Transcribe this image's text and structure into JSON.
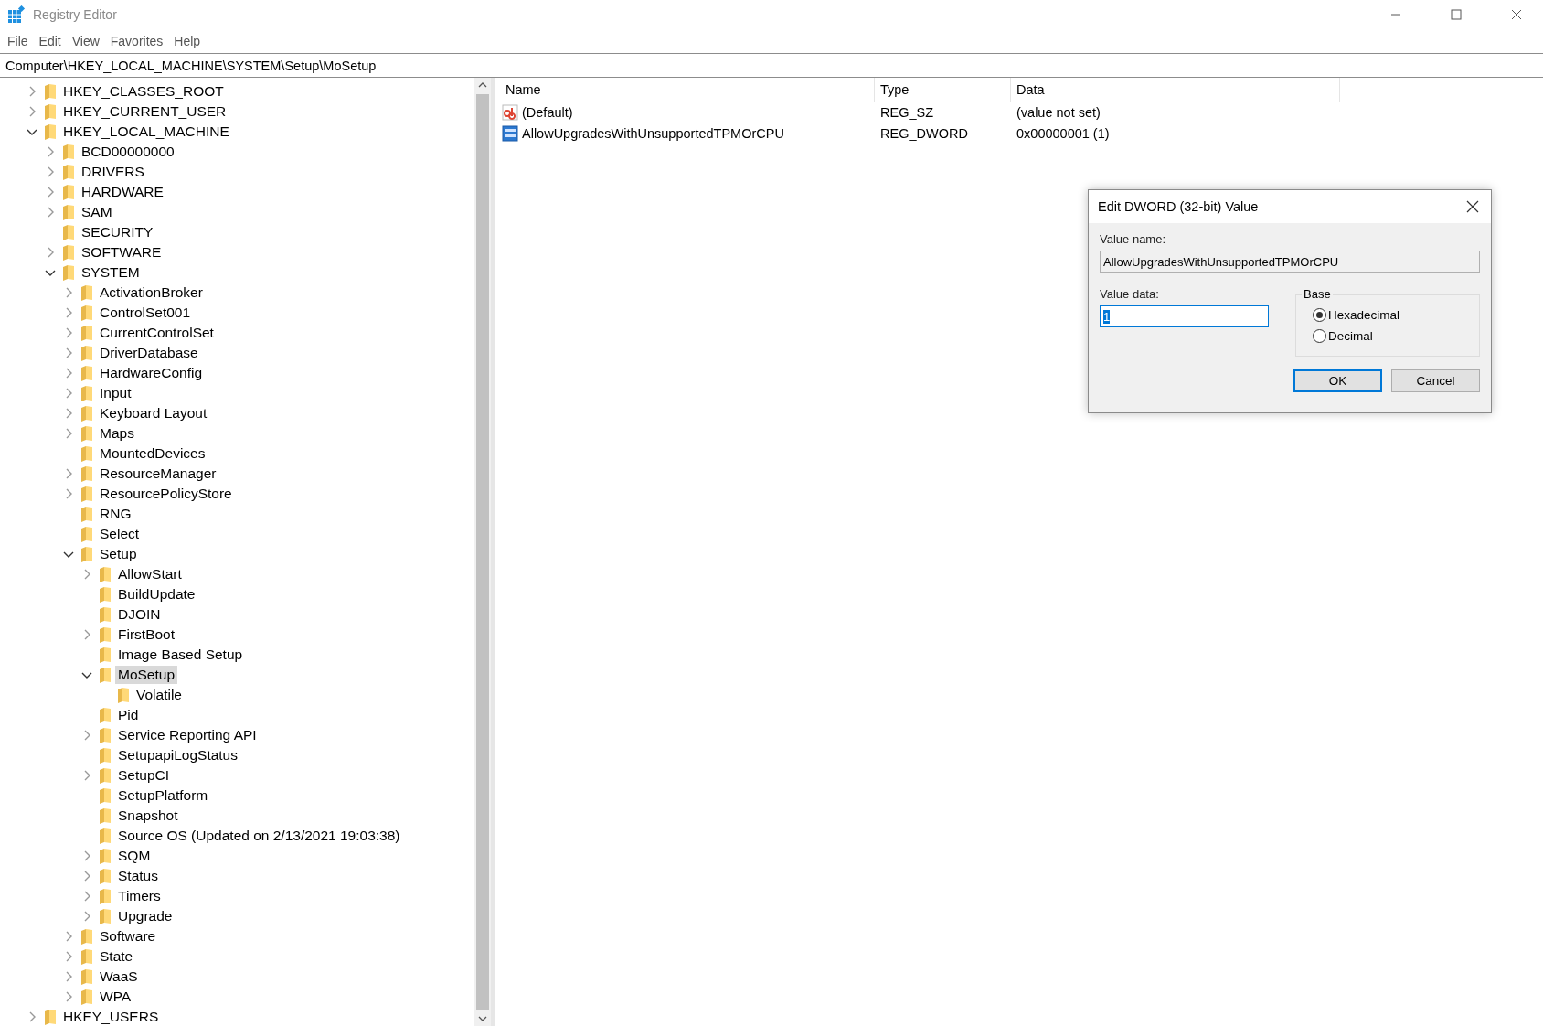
{
  "window": {
    "title": "Registry Editor"
  },
  "menu": [
    "File",
    "Edit",
    "View",
    "Favorites",
    "Help"
  ],
  "address": "Computer\\HKEY_LOCAL_MACHINE\\SYSTEM\\Setup\\MoSetup",
  "tree": [
    {
      "label": "HKEY_CLASSES_ROOT",
      "expandable": true,
      "expanded": false,
      "selected": false
    },
    {
      "label": "HKEY_CURRENT_USER",
      "expandable": true,
      "expanded": false,
      "selected": false
    },
    {
      "label": "HKEY_LOCAL_MACHINE",
      "expandable": true,
      "expanded": true,
      "selected": false,
      "children": [
        {
          "label": "BCD00000000",
          "expandable": true,
          "expanded": false,
          "selected": false
        },
        {
          "label": "DRIVERS",
          "expandable": true,
          "expanded": false,
          "selected": false
        },
        {
          "label": "HARDWARE",
          "expandable": true,
          "expanded": false,
          "selected": false
        },
        {
          "label": "SAM",
          "expandable": true,
          "expanded": false,
          "selected": false
        },
        {
          "label": "SECURITY",
          "expandable": false,
          "selected": false
        },
        {
          "label": "SOFTWARE",
          "expandable": true,
          "expanded": false,
          "selected": false
        },
        {
          "label": "SYSTEM",
          "expandable": true,
          "expanded": true,
          "selected": false,
          "children": [
            {
              "label": "ActivationBroker",
              "expandable": true,
              "expanded": false,
              "selected": false
            },
            {
              "label": "ControlSet001",
              "expandable": true,
              "expanded": false,
              "selected": false
            },
            {
              "label": "CurrentControlSet",
              "expandable": true,
              "expanded": false,
              "selected": false
            },
            {
              "label": "DriverDatabase",
              "expandable": true,
              "expanded": false,
              "selected": false
            },
            {
              "label": "HardwareConfig",
              "expandable": true,
              "expanded": false,
              "selected": false
            },
            {
              "label": "Input",
              "expandable": true,
              "expanded": false,
              "selected": false
            },
            {
              "label": "Keyboard Layout",
              "expandable": true,
              "expanded": false,
              "selected": false
            },
            {
              "label": "Maps",
              "expandable": true,
              "expanded": false,
              "selected": false
            },
            {
              "label": "MountedDevices",
              "expandable": false,
              "selected": false
            },
            {
              "label": "ResourceManager",
              "expandable": true,
              "expanded": false,
              "selected": false
            },
            {
              "label": "ResourcePolicyStore",
              "expandable": true,
              "expanded": false,
              "selected": false
            },
            {
              "label": "RNG",
              "expandable": false,
              "selected": false
            },
            {
              "label": "Select",
              "expandable": false,
              "selected": false
            },
            {
              "label": "Setup",
              "expandable": true,
              "expanded": true,
              "selected": false,
              "children": [
                {
                  "label": "AllowStart",
                  "expandable": true,
                  "expanded": false,
                  "selected": false
                },
                {
                  "label": "BuildUpdate",
                  "expandable": false,
                  "selected": false
                },
                {
                  "label": "DJOIN",
                  "expandable": false,
                  "selected": false
                },
                {
                  "label": "FirstBoot",
                  "expandable": true,
                  "expanded": false,
                  "selected": false
                },
                {
                  "label": "Image Based Setup",
                  "expandable": false,
                  "selected": false
                },
                {
                  "label": "MoSetup",
                  "expandable": true,
                  "expanded": true,
                  "selected": true,
                  "children": [
                    {
                      "label": "Volatile",
                      "expandable": false,
                      "selected": false
                    }
                  ]
                },
                {
                  "label": "Pid",
                  "expandable": false,
                  "selected": false
                },
                {
                  "label": "Service Reporting API",
                  "expandable": true,
                  "expanded": false,
                  "selected": false
                },
                {
                  "label": "SetupapiLogStatus",
                  "expandable": false,
                  "selected": false
                },
                {
                  "label": "SetupCI",
                  "expandable": true,
                  "expanded": false,
                  "selected": false
                },
                {
                  "label": "SetupPlatform",
                  "expandable": false,
                  "selected": false
                },
                {
                  "label": "Snapshot",
                  "expandable": false,
                  "selected": false
                },
                {
                  "label": "Source OS (Updated on 2/13/2021 19:03:38)",
                  "expandable": false,
                  "selected": false
                },
                {
                  "label": "SQM",
                  "expandable": true,
                  "expanded": false,
                  "selected": false
                },
                {
                  "label": "Status",
                  "expandable": true,
                  "expanded": false,
                  "selected": false
                },
                {
                  "label": "Timers",
                  "expandable": true,
                  "expanded": false,
                  "selected": false
                },
                {
                  "label": "Upgrade",
                  "expandable": true,
                  "expanded": false,
                  "selected": false
                }
              ]
            },
            {
              "label": "Software",
              "expandable": true,
              "expanded": false,
              "selected": false
            },
            {
              "label": "State",
              "expandable": true,
              "expanded": false,
              "selected": false
            },
            {
              "label": "WaaS",
              "expandable": true,
              "expanded": false,
              "selected": false
            },
            {
              "label": "WPA",
              "expandable": true,
              "expanded": false,
              "selected": false
            }
          ]
        }
      ]
    },
    {
      "label": "HKEY_USERS",
      "expandable": true,
      "expanded": false,
      "selected": false
    }
  ],
  "values": {
    "columns": [
      "Name",
      "Type",
      "Data"
    ],
    "rows": [
      {
        "kind": "string",
        "name": "(Default)",
        "type": "REG_SZ",
        "data": "(value not set)"
      },
      {
        "kind": "dword",
        "name": "AllowUpgradesWithUnsupportedTPMOrCPU",
        "type": "REG_DWORD",
        "data": "0x00000001 (1)"
      }
    ]
  },
  "dialog": {
    "title": "Edit DWORD (32-bit) Value",
    "value_name_label": "Value name:",
    "value_name": "AllowUpgradesWithUnsupportedTPMOrCPU",
    "value_data_label": "Value data:",
    "value_data": "1",
    "base_label": "Base",
    "base_options": [
      {
        "label": "Hexadecimal",
        "selected": true
      },
      {
        "label": "Decimal",
        "selected": false
      }
    ],
    "buttons": [
      {
        "label": "OK",
        "kind": "default"
      },
      {
        "label": "Cancel",
        "kind": "normal"
      }
    ]
  }
}
